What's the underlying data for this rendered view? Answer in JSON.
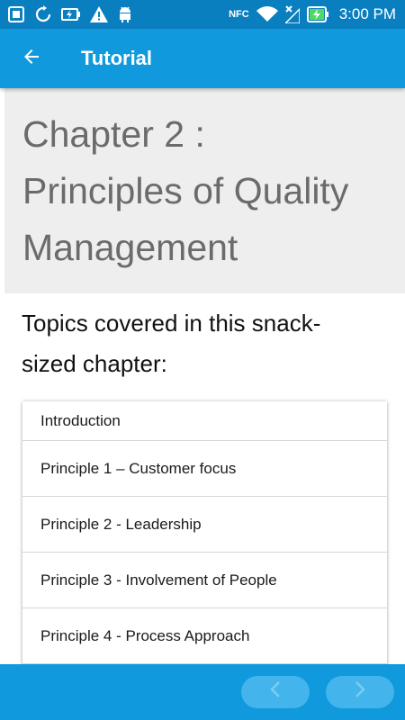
{
  "status_bar": {
    "time": "3:00 PM",
    "nfc_label": "NFC",
    "icons": [
      "screenshot-icon",
      "sync-icon",
      "battery-charging-small-icon",
      "warning-icon",
      "android-debug-icon",
      "nfc-icon",
      "wifi-icon",
      "no-signal-icon",
      "battery-charging-icon"
    ]
  },
  "app_bar": {
    "title": "Tutorial",
    "back_icon": "arrow-left-icon"
  },
  "chapter": {
    "title_line1": "Chapter 2 :",
    "title_line2": "Principles of Quality",
    "title_line3": "Management"
  },
  "topics": {
    "heading_line1": "Topics covered in this snack-",
    "heading_line2": "sized chapter:",
    "items": [
      "Introduction",
      "Principle 1 – Customer focus",
      "Principle 2 - Leadership",
      "Principle 3 - Involvement of People",
      "Principle 4 - Process Approach"
    ]
  },
  "bottom_nav": {
    "prev_icon": "chevron-left-icon",
    "next_icon": "chevron-right-icon"
  },
  "colors": {
    "status_bar": "#0a7fc0",
    "app_bar": "#1199dd",
    "header_bg": "#eeeeee",
    "nav_button": "#43b4ec"
  }
}
